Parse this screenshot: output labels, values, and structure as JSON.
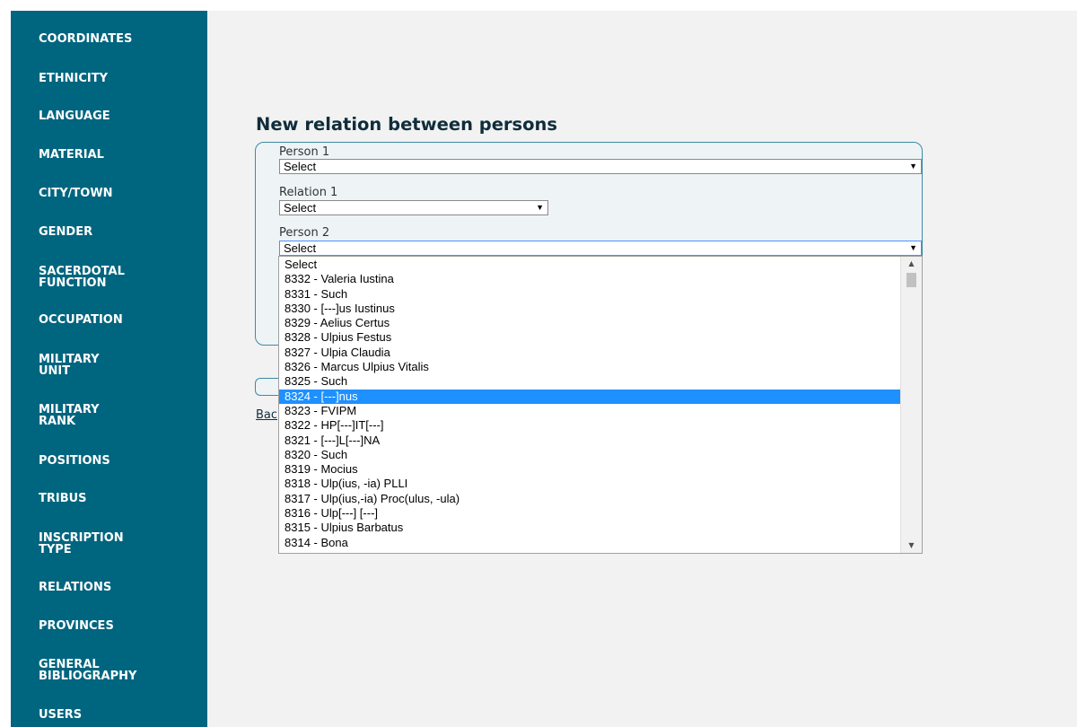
{
  "sidebar": {
    "items": [
      {
        "label": "COORDINATES"
      },
      {
        "label": "ETHNICITY"
      },
      {
        "label": "LANGUAGE"
      },
      {
        "label": "MATERIAL"
      },
      {
        "label": "CITY/TOWN"
      },
      {
        "label": "GENDER"
      },
      {
        "label": "SACERDOTAL\nFUNCTION"
      },
      {
        "label": "OCCUPATION"
      },
      {
        "label": "MILITARY\nUNIT"
      },
      {
        "label": "MILITARY\nRANK"
      },
      {
        "label": "POSITIONS"
      },
      {
        "label": "TRIBUS"
      },
      {
        "label": "INSCRIPTION\nTYPE"
      },
      {
        "label": "RELATIONS"
      },
      {
        "label": "PROVINCES"
      },
      {
        "label": "GENERAL\nBIBLIOGRAPHY"
      },
      {
        "label": "USERS"
      }
    ]
  },
  "form": {
    "title": "New relation between persons",
    "person1": {
      "label": "Person 1",
      "value": "Select"
    },
    "relation1": {
      "label": "Relation 1",
      "value": "Select"
    },
    "person2": {
      "label": "Person 2",
      "value": "Select"
    },
    "back_link": "Back"
  },
  "dropdown": {
    "options": [
      "Select",
      "8332 - Valeria Iustina",
      "8331 - Such",
      "8330 - [---]us Iustinus",
      "8329 - Aelius Certus",
      "8328 - Ulpius Festus",
      "8327 - Ulpia Claudia",
      "8326 - Marcus Ulpius Vitalis",
      "8325 - Such",
      "8324 - [---]nus",
      "8323 - FVIPM",
      "8322 - HP[---]IT[---]",
      "8321 - [---]L[---]NA",
      "8320 - Such",
      "8319 - Mocius",
      "8318 - Ulp(ius, -ia) PLLI",
      "8317 - Ulp(ius,-ia) Proc(ulus, -ula)",
      "8316 - Ulp[---] [---]",
      "8315 - Ulpius Barbatus",
      "8314 - Bona"
    ],
    "highlighted": "8324 - [---]nus"
  },
  "icons": {
    "select_arrow": "▼",
    "scroll_up": "▲",
    "scroll_down": "▼"
  },
  "colors": {
    "sidebar_bg": "#00657f",
    "page_bg": "#f2f2f2",
    "highlight": "#1e90ff",
    "title": "#0f2d3b"
  }
}
